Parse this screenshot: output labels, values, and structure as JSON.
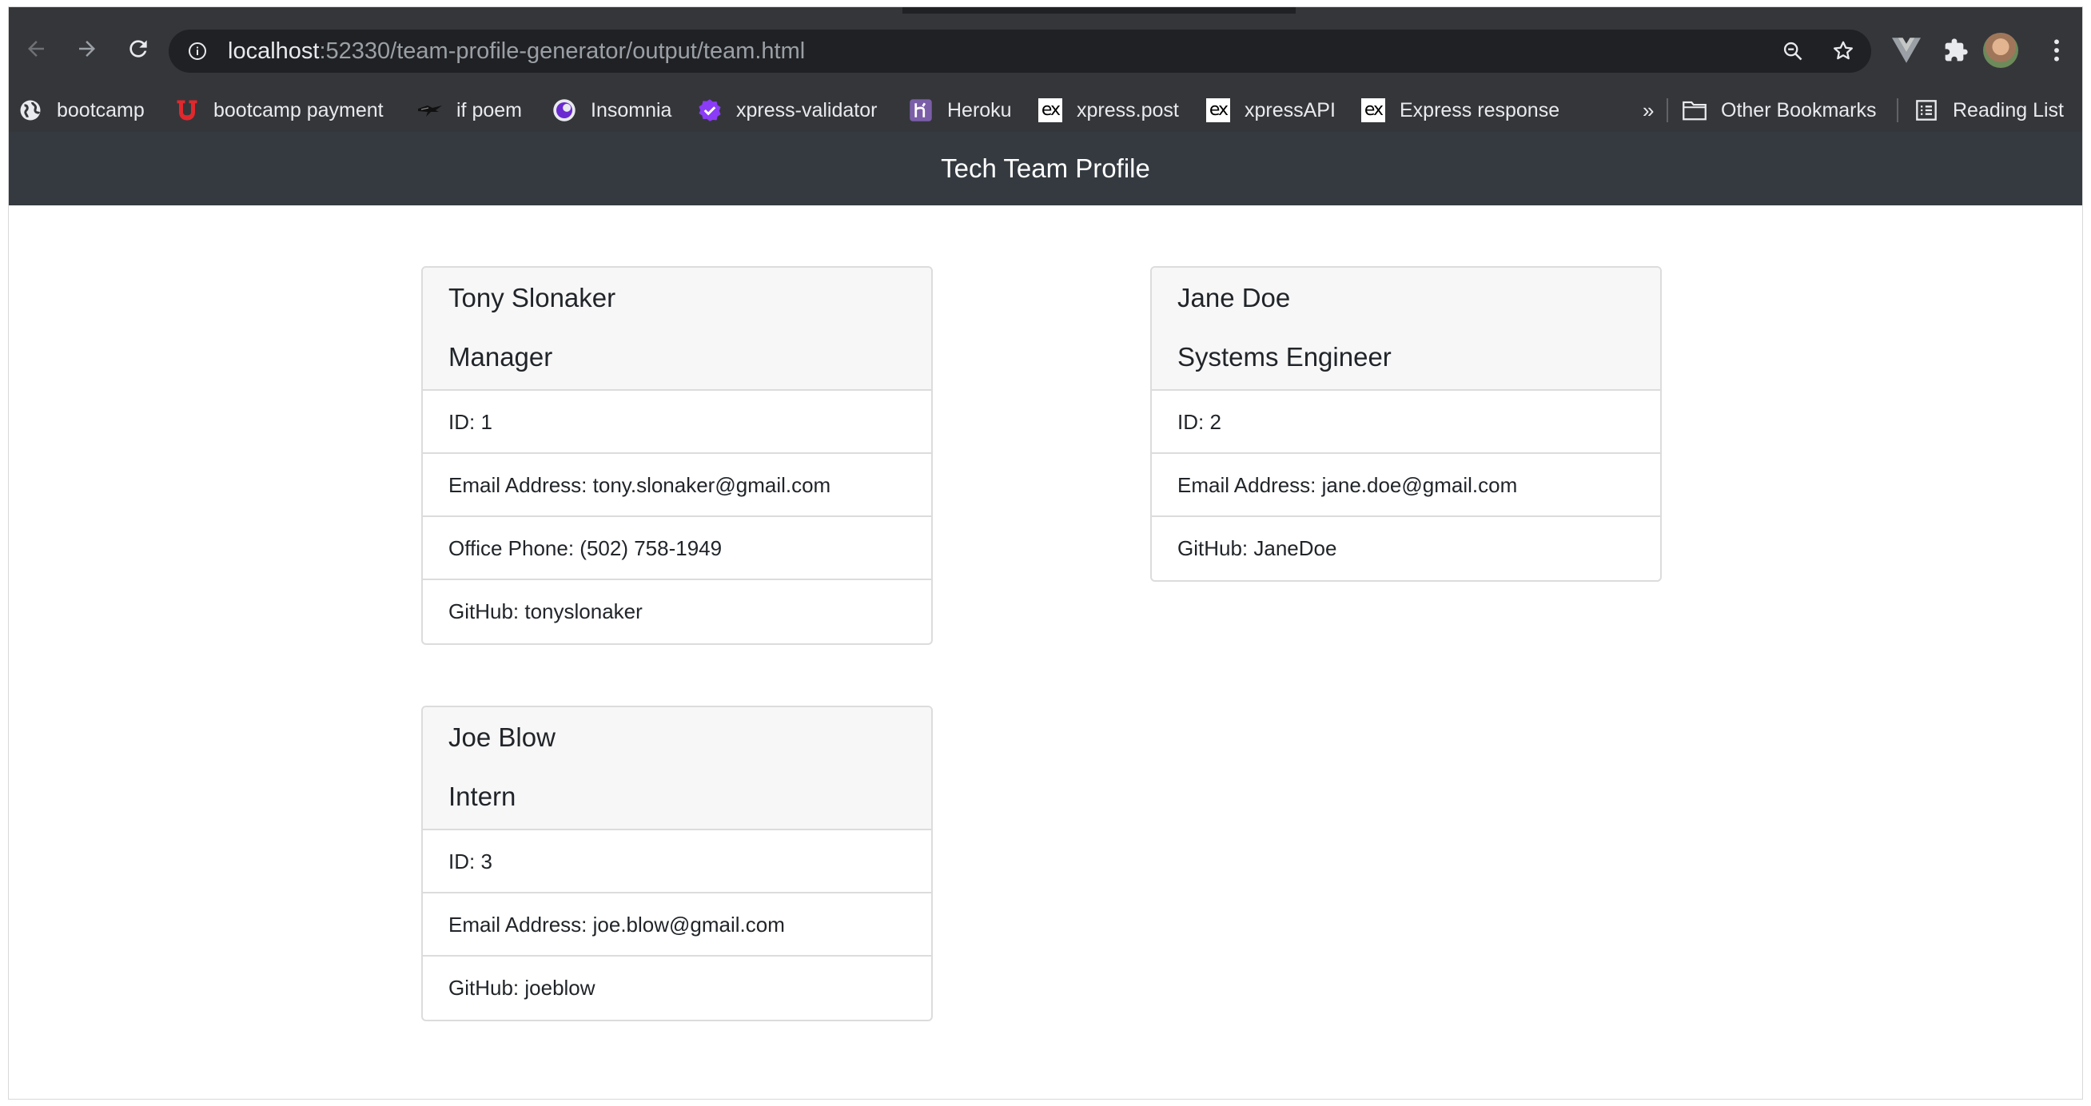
{
  "browser": {
    "url_host": "localhost",
    "url_path": ":52330/team-profile-generator/output/team.html",
    "bookmarks": [
      {
        "label": "bootcamp",
        "icon": "globe-icon"
      },
      {
        "label": "bootcamp payment",
        "icon": "u-logo-icon"
      },
      {
        "label": "if poem",
        "icon": "bird-icon"
      },
      {
        "label": "Insomnia",
        "icon": "insomnia-icon"
      },
      {
        "label": "xpress-validator",
        "icon": "check-badge-icon"
      },
      {
        "label": "Heroku",
        "icon": "heroku-icon"
      },
      {
        "label": "xpress.post",
        "icon": "ex-icon"
      },
      {
        "label": "xpressAPI",
        "icon": "ex-icon"
      },
      {
        "label": "Express response",
        "icon": "ex-icon"
      }
    ],
    "overflow_label": "»",
    "other_bookmarks": "Other Bookmarks",
    "reading_list": "Reading List",
    "ex_glyph": "ex"
  },
  "page": {
    "title": "Tech Team Profile"
  },
  "team": [
    {
      "name": "Tony Slonaker",
      "role": "Manager",
      "rows": [
        "ID: 1",
        "Email Address: tony.slonaker@gmail.com",
        "Office Phone: (502) 758-1949",
        "GitHub: tonyslonaker"
      ]
    },
    {
      "name": "Jane Doe",
      "role": "Systems Engineer",
      "rows": [
        "ID: 2",
        "Email Address: jane.doe@gmail.com",
        "GitHub: JaneDoe"
      ]
    },
    {
      "name": "Joe Blow",
      "role": "Intern",
      "rows": [
        "ID: 3",
        "Email Address: joe.blow@gmail.com",
        "GitHub: joeblow"
      ]
    }
  ],
  "colors": {
    "chrome_dark": "#35363a",
    "omnibox": "#202124",
    "header": "#343a40",
    "card_border": "#dcdcdc",
    "card_head_bg": "#f7f7f7"
  }
}
